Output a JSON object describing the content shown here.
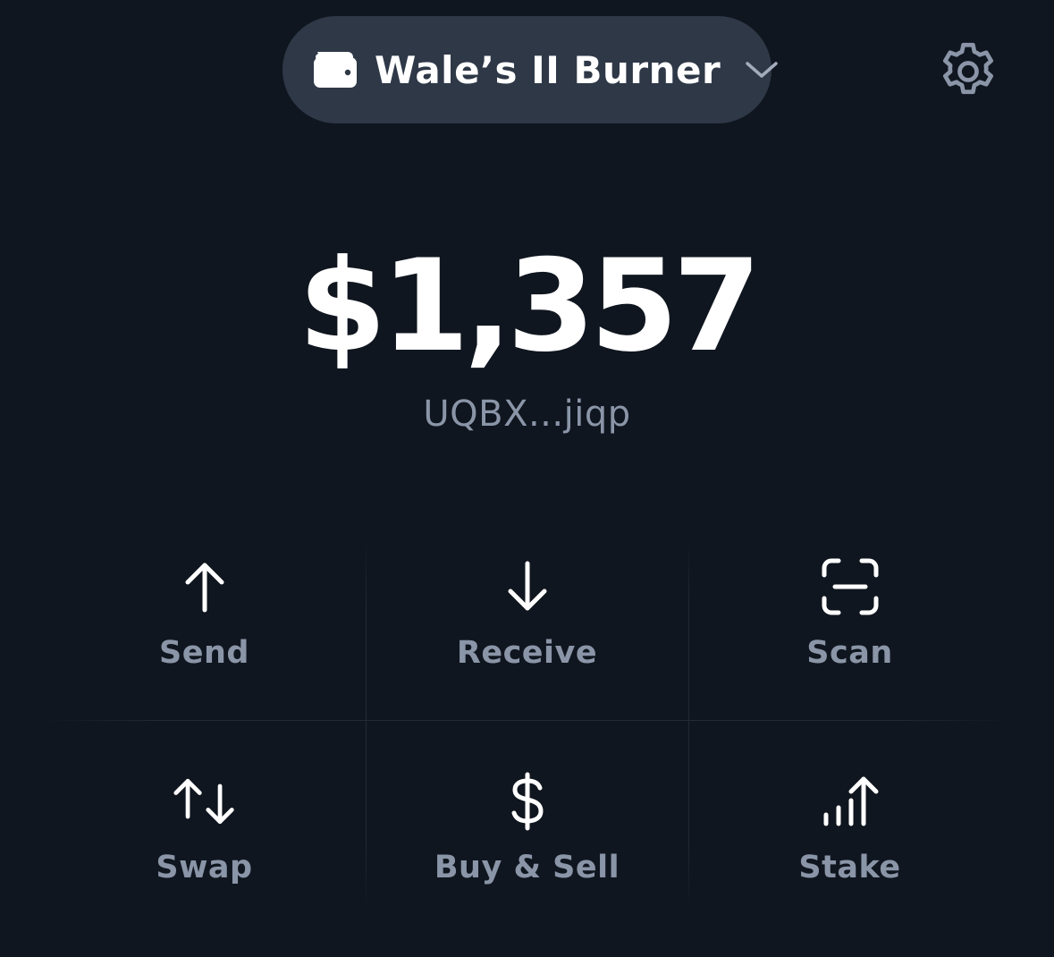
{
  "header": {
    "wallet_name": "Wale’s II Burner",
    "icons": {
      "wallet": "wallet-icon",
      "dropdown": "chevron-down-icon",
      "settings": "gear-icon"
    }
  },
  "balance": {
    "amount": "$1,357",
    "address": "UQBX...jiqp"
  },
  "actions": [
    {
      "label": "Send",
      "icon": "arrow-up-icon"
    },
    {
      "label": "Receive",
      "icon": "arrow-down-icon"
    },
    {
      "label": "Scan",
      "icon": "scan-icon"
    },
    {
      "label": "Swap",
      "icon": "swap-arrows-icon"
    },
    {
      "label": "Buy & Sell",
      "icon": "dollar-icon"
    },
    {
      "label": "Stake",
      "icon": "stake-chart-icon"
    }
  ],
  "colors": {
    "background": "#10161f",
    "pill": "#2e3847",
    "text_primary": "#ffffff",
    "text_secondary": "#8a95a8",
    "divider": "#222a36"
  }
}
